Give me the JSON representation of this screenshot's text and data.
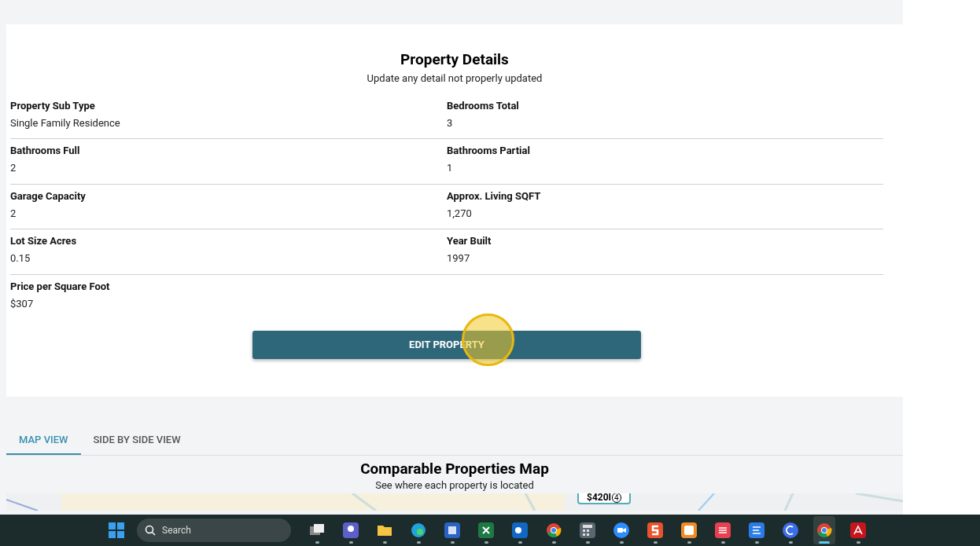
{
  "details": {
    "title": "Property Details",
    "subtitle": "Update any detail not properly updated",
    "fields": [
      {
        "label": "Property Sub Type",
        "value": "Single Family Residence"
      },
      {
        "label": "Bedrooms Total",
        "value": "3"
      },
      {
        "label": "Bathrooms Full",
        "value": "2"
      },
      {
        "label": "Bathrooms Partial",
        "value": "1"
      },
      {
        "label": "Garage Capacity",
        "value": "2"
      },
      {
        "label": "Approx. Living SQFT",
        "value": "1,270"
      },
      {
        "label": "Lot Size Acres",
        "value": "0.15"
      },
      {
        "label": "Year Built",
        "value": "1997"
      },
      {
        "label": "Price per Square Foot",
        "value": "$307"
      }
    ],
    "button": "EDIT PROPERTY"
  },
  "tabs": [
    {
      "label": "MAP VIEW",
      "selected": true
    },
    {
      "label": "SIDE BY SIDE VIEW",
      "selected": false
    }
  ],
  "map": {
    "title": "Comparable Properties Map",
    "subtitle": "See where each property is located",
    "marker": {
      "price": "$420I",
      "count": "4"
    }
  },
  "taskbar": {
    "search": "Search",
    "apps": [
      {
        "kind": "taskview",
        "active": false
      },
      {
        "kind": "teams",
        "active": false
      },
      {
        "kind": "folder",
        "active": false
      },
      {
        "kind": "edge",
        "active": false
      },
      {
        "kind": "word",
        "active": false
      },
      {
        "kind": "excel",
        "active": false
      },
      {
        "kind": "outlook",
        "active": false
      },
      {
        "kind": "chrome",
        "active": false
      },
      {
        "kind": "calculator",
        "active": false
      },
      {
        "kind": "zoom",
        "active": false
      },
      {
        "kind": "s",
        "active": false
      },
      {
        "kind": "r",
        "active": false
      },
      {
        "kind": "stripes",
        "active": false
      },
      {
        "kind": "doc",
        "active": false
      },
      {
        "kind": "c",
        "active": false
      },
      {
        "kind": "chrome",
        "active": true
      },
      {
        "kind": "pdf",
        "active": false
      }
    ]
  }
}
